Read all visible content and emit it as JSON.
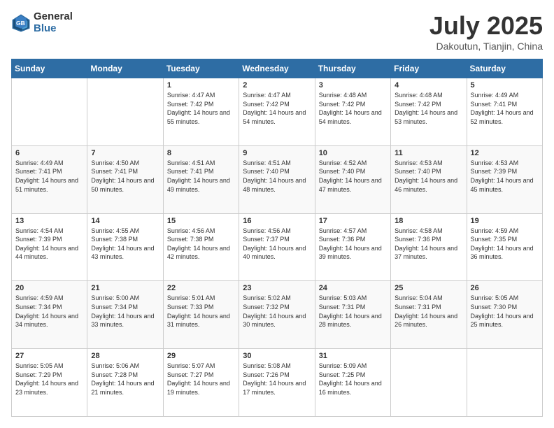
{
  "logo": {
    "general": "General",
    "blue": "Blue"
  },
  "title": {
    "month": "July 2025",
    "location": "Dakoutun, Tianjin, China"
  },
  "weekdays": [
    "Sunday",
    "Monday",
    "Tuesday",
    "Wednesday",
    "Thursday",
    "Friday",
    "Saturday"
  ],
  "weeks": [
    [
      {
        "day": "",
        "sunrise": "",
        "sunset": "",
        "daylight": ""
      },
      {
        "day": "",
        "sunrise": "",
        "sunset": "",
        "daylight": ""
      },
      {
        "day": "1",
        "sunrise": "Sunrise: 4:47 AM",
        "sunset": "Sunset: 7:42 PM",
        "daylight": "Daylight: 14 hours and 55 minutes."
      },
      {
        "day": "2",
        "sunrise": "Sunrise: 4:47 AM",
        "sunset": "Sunset: 7:42 PM",
        "daylight": "Daylight: 14 hours and 54 minutes."
      },
      {
        "day": "3",
        "sunrise": "Sunrise: 4:48 AM",
        "sunset": "Sunset: 7:42 PM",
        "daylight": "Daylight: 14 hours and 54 minutes."
      },
      {
        "day": "4",
        "sunrise": "Sunrise: 4:48 AM",
        "sunset": "Sunset: 7:42 PM",
        "daylight": "Daylight: 14 hours and 53 minutes."
      },
      {
        "day": "5",
        "sunrise": "Sunrise: 4:49 AM",
        "sunset": "Sunset: 7:41 PM",
        "daylight": "Daylight: 14 hours and 52 minutes."
      }
    ],
    [
      {
        "day": "6",
        "sunrise": "Sunrise: 4:49 AM",
        "sunset": "Sunset: 7:41 PM",
        "daylight": "Daylight: 14 hours and 51 minutes."
      },
      {
        "day": "7",
        "sunrise": "Sunrise: 4:50 AM",
        "sunset": "Sunset: 7:41 PM",
        "daylight": "Daylight: 14 hours and 50 minutes."
      },
      {
        "day": "8",
        "sunrise": "Sunrise: 4:51 AM",
        "sunset": "Sunset: 7:41 PM",
        "daylight": "Daylight: 14 hours and 49 minutes."
      },
      {
        "day": "9",
        "sunrise": "Sunrise: 4:51 AM",
        "sunset": "Sunset: 7:40 PM",
        "daylight": "Daylight: 14 hours and 48 minutes."
      },
      {
        "day": "10",
        "sunrise": "Sunrise: 4:52 AM",
        "sunset": "Sunset: 7:40 PM",
        "daylight": "Daylight: 14 hours and 47 minutes."
      },
      {
        "day": "11",
        "sunrise": "Sunrise: 4:53 AM",
        "sunset": "Sunset: 7:40 PM",
        "daylight": "Daylight: 14 hours and 46 minutes."
      },
      {
        "day": "12",
        "sunrise": "Sunrise: 4:53 AM",
        "sunset": "Sunset: 7:39 PM",
        "daylight": "Daylight: 14 hours and 45 minutes."
      }
    ],
    [
      {
        "day": "13",
        "sunrise": "Sunrise: 4:54 AM",
        "sunset": "Sunset: 7:39 PM",
        "daylight": "Daylight: 14 hours and 44 minutes."
      },
      {
        "day": "14",
        "sunrise": "Sunrise: 4:55 AM",
        "sunset": "Sunset: 7:38 PM",
        "daylight": "Daylight: 14 hours and 43 minutes."
      },
      {
        "day": "15",
        "sunrise": "Sunrise: 4:56 AM",
        "sunset": "Sunset: 7:38 PM",
        "daylight": "Daylight: 14 hours and 42 minutes."
      },
      {
        "day": "16",
        "sunrise": "Sunrise: 4:56 AM",
        "sunset": "Sunset: 7:37 PM",
        "daylight": "Daylight: 14 hours and 40 minutes."
      },
      {
        "day": "17",
        "sunrise": "Sunrise: 4:57 AM",
        "sunset": "Sunset: 7:36 PM",
        "daylight": "Daylight: 14 hours and 39 minutes."
      },
      {
        "day": "18",
        "sunrise": "Sunrise: 4:58 AM",
        "sunset": "Sunset: 7:36 PM",
        "daylight": "Daylight: 14 hours and 37 minutes."
      },
      {
        "day": "19",
        "sunrise": "Sunrise: 4:59 AM",
        "sunset": "Sunset: 7:35 PM",
        "daylight": "Daylight: 14 hours and 36 minutes."
      }
    ],
    [
      {
        "day": "20",
        "sunrise": "Sunrise: 4:59 AM",
        "sunset": "Sunset: 7:34 PM",
        "daylight": "Daylight: 14 hours and 34 minutes."
      },
      {
        "day": "21",
        "sunrise": "Sunrise: 5:00 AM",
        "sunset": "Sunset: 7:34 PM",
        "daylight": "Daylight: 14 hours and 33 minutes."
      },
      {
        "day": "22",
        "sunrise": "Sunrise: 5:01 AM",
        "sunset": "Sunset: 7:33 PM",
        "daylight": "Daylight: 14 hours and 31 minutes."
      },
      {
        "day": "23",
        "sunrise": "Sunrise: 5:02 AM",
        "sunset": "Sunset: 7:32 PM",
        "daylight": "Daylight: 14 hours and 30 minutes."
      },
      {
        "day": "24",
        "sunrise": "Sunrise: 5:03 AM",
        "sunset": "Sunset: 7:31 PM",
        "daylight": "Daylight: 14 hours and 28 minutes."
      },
      {
        "day": "25",
        "sunrise": "Sunrise: 5:04 AM",
        "sunset": "Sunset: 7:31 PM",
        "daylight": "Daylight: 14 hours and 26 minutes."
      },
      {
        "day": "26",
        "sunrise": "Sunrise: 5:05 AM",
        "sunset": "Sunset: 7:30 PM",
        "daylight": "Daylight: 14 hours and 25 minutes."
      }
    ],
    [
      {
        "day": "27",
        "sunrise": "Sunrise: 5:05 AM",
        "sunset": "Sunset: 7:29 PM",
        "daylight": "Daylight: 14 hours and 23 minutes."
      },
      {
        "day": "28",
        "sunrise": "Sunrise: 5:06 AM",
        "sunset": "Sunset: 7:28 PM",
        "daylight": "Daylight: 14 hours and 21 minutes."
      },
      {
        "day": "29",
        "sunrise": "Sunrise: 5:07 AM",
        "sunset": "Sunset: 7:27 PM",
        "daylight": "Daylight: 14 hours and 19 minutes."
      },
      {
        "day": "30",
        "sunrise": "Sunrise: 5:08 AM",
        "sunset": "Sunset: 7:26 PM",
        "daylight": "Daylight: 14 hours and 17 minutes."
      },
      {
        "day": "31",
        "sunrise": "Sunrise: 5:09 AM",
        "sunset": "Sunset: 7:25 PM",
        "daylight": "Daylight: 14 hours and 16 minutes."
      },
      {
        "day": "",
        "sunrise": "",
        "sunset": "",
        "daylight": ""
      },
      {
        "day": "",
        "sunrise": "",
        "sunset": "",
        "daylight": ""
      }
    ]
  ]
}
